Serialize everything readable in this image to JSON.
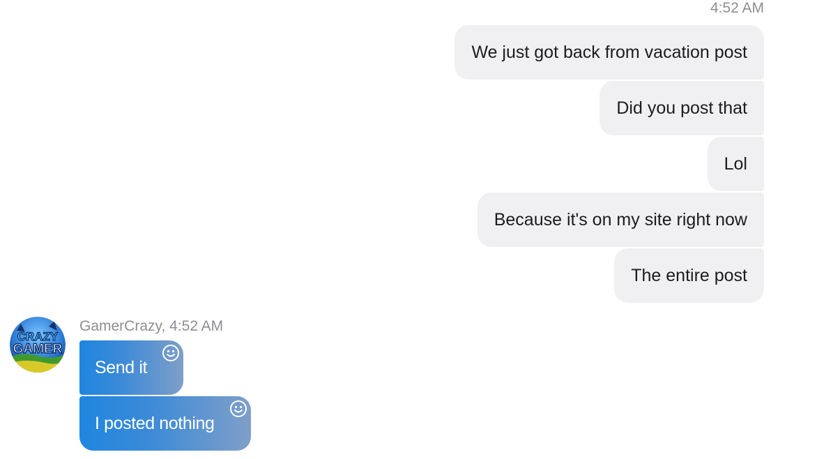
{
  "conversation": {
    "outgoing_timestamp": "4:52 AM",
    "outgoing_messages": [
      "We just got back from vacation post",
      "Did you post that",
      "Lol",
      "Because it's on my site right now",
      "The entire post"
    ],
    "incoming": {
      "sender_line": "GamerCrazy, 4:52 AM",
      "avatar_label": "CRAZY GAMER",
      "messages": [
        "Send it",
        "I posted nothing"
      ]
    }
  },
  "colors": {
    "outgoing_bubble": "#f0f0f2",
    "incoming_bubble_start": "#1f86e0",
    "incoming_bubble_end": "#7f9fc8",
    "meta_text": "#8e8e93"
  },
  "icons": {
    "reaction": "smiley-icon"
  }
}
